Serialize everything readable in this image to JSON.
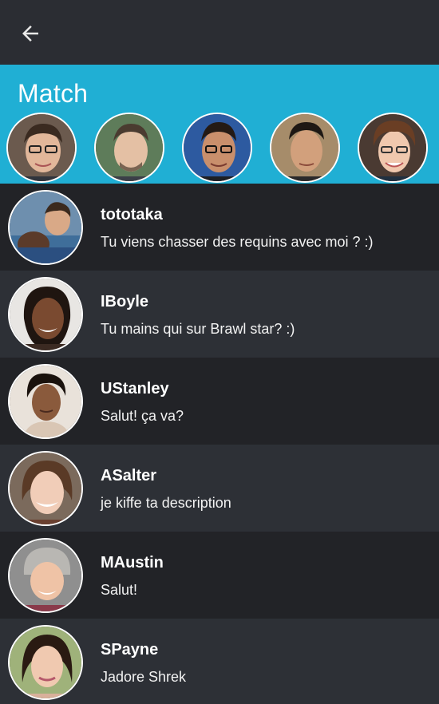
{
  "header": {
    "back_icon": "arrow-left-icon"
  },
  "match": {
    "title": "Match",
    "background": "#20afd4",
    "avatars": [
      {
        "icon": "user-avatar-icon"
      },
      {
        "icon": "user-avatar-icon"
      },
      {
        "icon": "user-avatar-icon"
      },
      {
        "icon": "user-avatar-icon"
      },
      {
        "icon": "user-avatar-icon"
      }
    ]
  },
  "conversations": [
    {
      "name": "tototaka",
      "message": "Tu viens chasser des requins avec moi ? :)"
    },
    {
      "name": "IBoyle",
      "message": "Tu mains qui sur Brawl star? :)"
    },
    {
      "name": "UStanley",
      "message": "Salut! ça va?"
    },
    {
      "name": "ASalter",
      "message": "je kiffe ta description"
    },
    {
      "name": "MAustin",
      "message": "Salut!"
    },
    {
      "name": "SPayne",
      "message": "Jadore Shrek"
    }
  ]
}
